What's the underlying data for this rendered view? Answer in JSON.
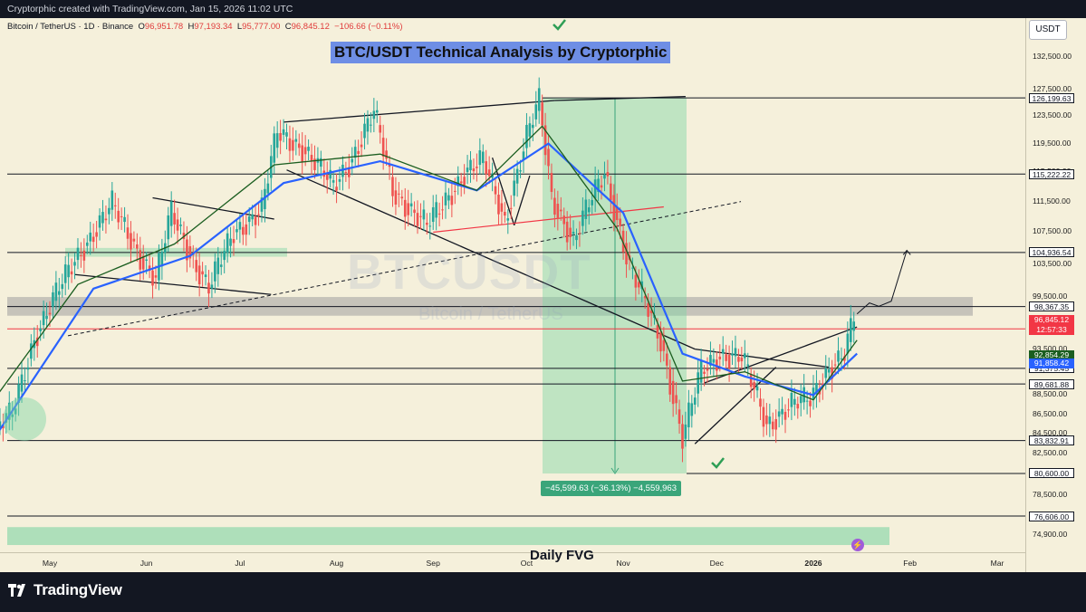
{
  "header": {
    "created_text": "Cryptorphic created with TradingView.com, Jan 15, 2026 11:02 UTC"
  },
  "legend": {
    "symbol": "Bitcoin / TetherUS · 1D · Binance",
    "open_label": "O",
    "open": "96,951.78",
    "high_label": "H",
    "high": "97,193.34",
    "low_label": "L",
    "low": "95,777.00",
    "close_label": "C",
    "close": "96,845.12",
    "change": "−106.66 (−0.11%)"
  },
  "currency_button": "USDT",
  "annotation_title": "BTC/USDT Technical Analysis by Cryptorphic",
  "watermark": {
    "symbol": "BTCUSDT",
    "name": "Bitcoin / TetherUS"
  },
  "measure_label": "−45,599.63 (−36.13%) −4,559,963",
  "fvg_label": "Daily FVG",
  "footer": {
    "brand": "TradingView"
  },
  "colors": {
    "background": "#f5f0db",
    "up": "#26a69a",
    "down": "#ef5350",
    "ema_blue": "#2962ff",
    "ema_green": "#1b5e20",
    "resistance_red": "#f23645",
    "measure_green": "#3aa57a"
  },
  "chart_data": {
    "type": "candlestick",
    "title": "BTC/USDT Technical Analysis by Cryptorphic",
    "symbol": "BTCUSDT",
    "timeframe": "1D",
    "exchange": "Binance",
    "y_axis": {
      "scale": "log",
      "range": [
        74000,
        136000
      ],
      "ticks": [
        132500,
        127500,
        123500,
        119500,
        115500,
        111500,
        107500,
        103500,
        99500,
        93500,
        88500,
        86500,
        84500,
        82500,
        78500,
        74900
      ],
      "tick_labels": [
        "132,500.00",
        "127,500.00",
        "123,500.00",
        "119,500.00",
        "115,500.00",
        "111,500.00",
        "107,500.00",
        "103,500.00",
        "99,500.00",
        "93,500.00",
        "88,500.00",
        "86,500.00",
        "84,500.00",
        "82,500.00",
        "78,500.00",
        "74,900.00"
      ]
    },
    "x_axis": {
      "labels": [
        "May",
        "Jun",
        "Jul",
        "Aug",
        "Sep",
        "Oct",
        "Nov",
        "Dec",
        "2026",
        "Feb",
        "Mar"
      ],
      "label_dates": [
        "2025-05-01",
        "2025-06-01",
        "2025-07-01",
        "2025-08-01",
        "2025-09-01",
        "2025-10-01",
        "2025-11-01",
        "2025-12-01",
        "2026-01-01",
        "2026-02-01",
        "2026-03-01"
      ]
    },
    "price_path": [
      [
        "2025-04-13",
        84500
      ],
      [
        "2025-04-20",
        86500
      ],
      [
        "2025-04-27",
        94800
      ],
      [
        "2025-05-10",
        104000
      ],
      [
        "2025-05-22",
        111000
      ],
      [
        "2025-05-31",
        104500
      ],
      [
        "2025-06-05",
        101500
      ],
      [
        "2025-06-10",
        110000
      ],
      [
        "2025-06-17",
        104000
      ],
      [
        "2025-06-22",
        100500
      ],
      [
        "2025-06-30",
        107500
      ],
      [
        "2025-07-09",
        110500
      ],
      [
        "2025-07-14",
        121000
      ],
      [
        "2025-07-22",
        119000
      ],
      [
        "2025-08-01",
        113500
      ],
      [
        "2025-08-07",
        117500
      ],
      [
        "2025-08-14",
        124000
      ],
      [
        "2025-08-20",
        113000
      ],
      [
        "2025-08-31",
        108300
      ],
      [
        "2025-09-05",
        111000
      ],
      [
        "2025-09-12",
        115500
      ],
      [
        "2025-09-18",
        117000
      ],
      [
        "2025-09-25",
        109000
      ],
      [
        "2025-10-02",
        120500
      ],
      [
        "2025-10-06",
        125500
      ],
      [
        "2025-10-10",
        112000
      ],
      [
        "2025-10-17",
        106500
      ],
      [
        "2025-10-27",
        115500
      ],
      [
        "2025-11-04",
        103000
      ],
      [
        "2025-11-14",
        94500
      ],
      [
        "2025-11-21",
        84000
      ],
      [
        "2025-11-27",
        91000
      ],
      [
        "2025-12-03",
        93000
      ],
      [
        "2025-12-10",
        92500
      ],
      [
        "2025-12-18",
        85500
      ],
      [
        "2025-12-26",
        87500
      ],
      [
        "2026-01-01",
        88000
      ],
      [
        "2026-01-07",
        91500
      ],
      [
        "2026-01-12",
        93000
      ],
      [
        "2026-01-15",
        96845.12
      ]
    ],
    "moving_averages": [
      {
        "color": "#2962ff",
        "path": [
          [
            "2025-04-13",
            84000
          ],
          [
            "2025-05-15",
            100500
          ],
          [
            "2025-06-15",
            104500
          ],
          [
            "2025-07-15",
            114000
          ],
          [
            "2025-08-15",
            117000
          ],
          [
            "2025-09-15",
            113000
          ],
          [
            "2025-10-08",
            119500
          ],
          [
            "2025-11-01",
            110000
          ],
          [
            "2025-11-20",
            93000
          ],
          [
            "2025-12-10",
            90500
          ],
          [
            "2026-01-01",
            88500
          ],
          [
            "2026-01-15",
            93000
          ]
        ]
      },
      {
        "color": "#1b5e20",
        "path": [
          [
            "2025-04-13",
            88000
          ],
          [
            "2025-05-10",
            101000
          ],
          [
            "2025-06-10",
            106000
          ],
          [
            "2025-07-12",
            116500
          ],
          [
            "2025-08-15",
            118000
          ],
          [
            "2025-09-15",
            113000
          ],
          [
            "2025-10-06",
            122000
          ],
          [
            "2025-10-30",
            108000
          ],
          [
            "2025-11-20",
            90000
          ],
          [
            "2025-12-10",
            91000
          ],
          [
            "2026-01-01",
            88000
          ],
          [
            "2026-01-15",
            94500
          ]
        ]
      }
    ],
    "horizontal_levels": [
      {
        "price": 126199.63,
        "label": "126,199.63",
        "color": "#131722"
      },
      {
        "price": 115222.22,
        "label": "115,222.22",
        "color": "#131722"
      },
      {
        "price": 104936.54,
        "label": "104,936.54",
        "color": "#131722"
      },
      {
        "price": 98367.35,
        "label": "98,367.35",
        "color": "#131722"
      },
      {
        "price": 95784.61,
        "label": "95,784.61",
        "color": "#f23645"
      },
      {
        "price": 91375.45,
        "label": "91,375.45",
        "color": "#131722"
      },
      {
        "price": 89681.88,
        "label": "89,681.88",
        "color": "#131722"
      },
      {
        "price": 83832.91,
        "label": "83,832.91",
        "color": "#131722"
      },
      {
        "price": 80600.0,
        "label": "80,600.00",
        "color": "#131722"
      },
      {
        "price": 76606.0,
        "label": "76,606.00",
        "color": "#131722"
      }
    ],
    "price_labels": [
      {
        "price": 96845.12,
        "label": "96,845.12",
        "sub": "12:57:33",
        "bg": "#f23645",
        "fg": "#ffffff"
      },
      {
        "price": 92854.29,
        "label": "92,854.29",
        "bg": "#1b5e20",
        "fg": "#ffffff"
      },
      {
        "price": 91858.42,
        "label": "91,858.42",
        "bg": "#2962ff",
        "fg": "#ffffff"
      }
    ],
    "zones": [
      {
        "kind": "supply",
        "from": 97300,
        "to": 99500,
        "color": "#9e9e9e"
      },
      {
        "kind": "fvg",
        "from": 74000,
        "to": 75600,
        "color": "#7fd4a3",
        "label": "Daily FVG"
      }
    ],
    "measure": {
      "from_price": 126199.63,
      "to_price": 80600.0,
      "change": -45599.63,
      "change_pct": -36.13,
      "label": "−45,599.63 (−36.13%) −4,559,963"
    },
    "projection": [
      [
        "2026-01-15",
        97500
      ],
      [
        "2026-01-19",
        98800
      ],
      [
        "2026-01-22",
        98400
      ],
      [
        "2026-01-26",
        99000
      ],
      [
        "2026-01-31",
        105200
      ]
    ]
  }
}
